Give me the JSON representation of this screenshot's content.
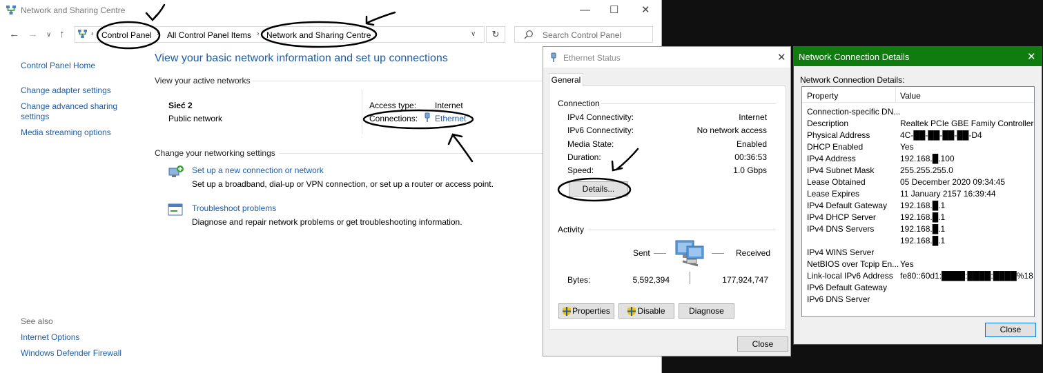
{
  "control_panel": {
    "window_title": "Network and Sharing Centre",
    "breadcrumb": [
      "Control Panel",
      "All Control Panel Items",
      "Network and Sharing Centre"
    ],
    "search_placeholder": "Search Control Panel",
    "sidebar": {
      "home": "Control Panel Home",
      "items": [
        "Change adapter settings",
        "Change advanced sharing settings",
        "Media streaming options"
      ],
      "see_also_label": "See also",
      "see_also": [
        "Internet Options",
        "Windows Defender Firewall"
      ]
    },
    "heading": "View your basic network information and set up connections",
    "active_networks_label": "View your active networks",
    "network": {
      "name": "Sieć 2",
      "category": "Public network",
      "access_type_label": "Access type:",
      "access_type_value": "Internet",
      "connections_label": "Connections:",
      "connections_value": "Ethernet"
    },
    "change_settings_label": "Change your networking settings",
    "tasks": [
      {
        "title": "Set up a new connection or network",
        "desc": "Set up a broadband, dial-up or VPN connection, or set up a router or access point."
      },
      {
        "title": "Troubleshoot problems",
        "desc": "Diagnose and repair network problems or get troubleshooting information."
      }
    ]
  },
  "ethernet_status": {
    "title": "Ethernet Status",
    "tab": "General",
    "connection_group": "Connection",
    "rows": [
      {
        "label": "IPv4 Connectivity:",
        "value": "Internet"
      },
      {
        "label": "IPv6 Connectivity:",
        "value": "No network access"
      },
      {
        "label": "Media State:",
        "value": "Enabled"
      },
      {
        "label": "Duration:",
        "value": "00:36:53"
      },
      {
        "label": "Speed:",
        "value": "1.0 Gbps"
      }
    ],
    "details_button": "Details...",
    "activity_group": "Activity",
    "sent_label": "Sent",
    "received_label": "Received",
    "bytes_label": "Bytes:",
    "bytes_sent": "5,592,394",
    "bytes_received": "177,924,747",
    "properties_button": "Properties",
    "disable_button": "Disable",
    "diagnose_button": "Diagnose",
    "close_button": "Close"
  },
  "connection_details": {
    "title": "Network Connection Details",
    "label": "Network Connection Details:",
    "col_property": "Property",
    "col_value": "Value",
    "rows": [
      {
        "property": "Connection-specific DN...",
        "value": ""
      },
      {
        "property": "Description",
        "value": "Realtek PCIe GBE Family Controller"
      },
      {
        "property": "Physical Address",
        "value": "4C-██-██-██-██-D4"
      },
      {
        "property": "DHCP Enabled",
        "value": "Yes"
      },
      {
        "property": "IPv4 Address",
        "value": "192.168.█.100"
      },
      {
        "property": "IPv4 Subnet Mask",
        "value": "255.255.255.0"
      },
      {
        "property": "Lease Obtained",
        "value": "05 December 2020 09:34:45"
      },
      {
        "property": "Lease Expires",
        "value": "11 January 2157 16:39:44"
      },
      {
        "property": "IPv4 Default Gateway",
        "value": "192.168.█.1"
      },
      {
        "property": "IPv4 DHCP Server",
        "value": "192.168.█.1"
      },
      {
        "property": "IPv4 DNS Servers",
        "value": "192.168.█.1"
      },
      {
        "property": "",
        "value": "192.168.█.1"
      },
      {
        "property": "IPv4 WINS Server",
        "value": ""
      },
      {
        "property": "NetBIOS over Tcpip En...",
        "value": "Yes"
      },
      {
        "property": "Link-local IPv6 Address",
        "value": "fe80::60d1:████:████:████%18"
      },
      {
        "property": "IPv6 Default Gateway",
        "value": ""
      },
      {
        "property": "IPv6 DNS Server",
        "value": ""
      }
    ],
    "close_button": "Close"
  },
  "colors": {
    "link": "#1f5ea8",
    "heading": "#1e5aa0",
    "details_titlebar": "#107c10",
    "desktop": "#101010"
  }
}
